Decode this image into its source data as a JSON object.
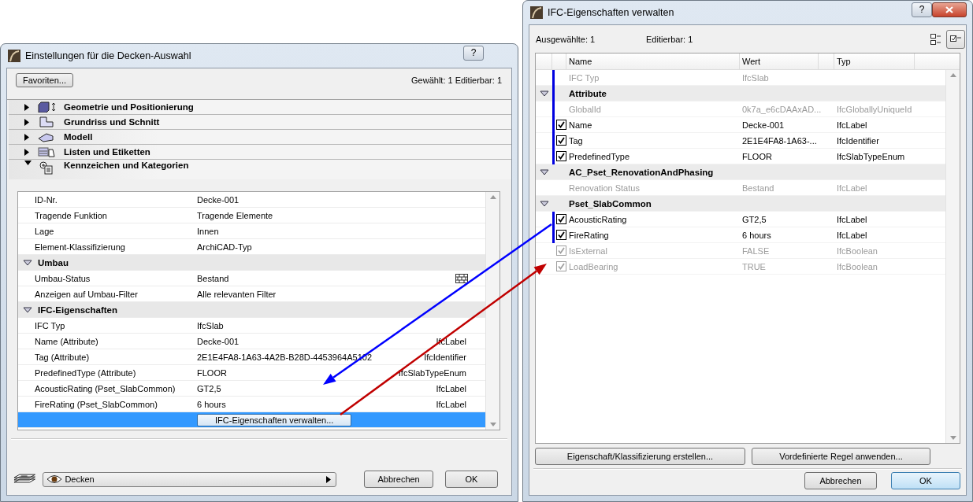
{
  "left_window": {
    "title": "Einstellungen für die Decken-Auswahl",
    "help_button": "?",
    "favorites_button": "Favoriten...",
    "selection_info": "Gewählt: 1 Editierbar: 1",
    "sections": [
      {
        "kind": "geometry",
        "label": "Geometrie und Positionierung",
        "expanded": false
      },
      {
        "kind": "plan",
        "label": "Grundriss und Schnitt",
        "expanded": false
      },
      {
        "kind": "model",
        "label": "Modell",
        "expanded": false
      },
      {
        "kind": "listing",
        "label": "Listen und Etiketten",
        "expanded": false
      },
      {
        "kind": "tags",
        "label": "Kennzeichen und Kategorien",
        "expanded": true
      }
    ],
    "rows": [
      {
        "kind": "row",
        "label": "ID-Nr.",
        "value": "Decke-001",
        "selected": false
      },
      {
        "kind": "row",
        "label": "Tragende Funktion",
        "value": "Tragende Elemente",
        "selected": false
      },
      {
        "kind": "row",
        "label": "Lage",
        "value": "Innen",
        "selected": false
      },
      {
        "kind": "row",
        "label": "Element-Klassifizierung",
        "value": "ArchiCAD-Typ",
        "selected": false
      },
      {
        "kind": "group",
        "label": "Umbau",
        "selected": false
      },
      {
        "kind": "status",
        "label": "Umbau-Status",
        "value": "Bestand",
        "selected": false
      },
      {
        "kind": "row",
        "label": "Anzeigen auf Umbau-Filter",
        "value": "Alle relevanten Filter",
        "selected": false
      },
      {
        "kind": "group",
        "label": "IFC-Eigenschaften",
        "selected": false
      },
      {
        "kind": "row",
        "label": "IFC Typ",
        "value": "IfcSlab",
        "selected": false
      },
      {
        "kind": "row",
        "label": "Name (Attribute)",
        "value": "Decke-001",
        "type": "IfcLabel",
        "selected": false
      },
      {
        "kind": "row",
        "label": "Tag (Attribute)",
        "value": "2E1E4FA8-1A63-4A2B-B28D-4453964A5102",
        "type": "IfcIdentifier",
        "selected": false
      },
      {
        "kind": "row",
        "label": "PredefinedType (Attribute)",
        "value": "FLOOR",
        "type": "IfcSlabTypeEnum",
        "selected": false
      },
      {
        "kind": "row",
        "label": "AcousticRating (Pset_SlabCommon)",
        "value": "GT2,5",
        "type": "IfcLabel",
        "selected": false
      },
      {
        "kind": "row",
        "label": "FireRating (Pset_SlabCommon)",
        "value": "6 hours",
        "type": "IfcLabel",
        "selected": false
      },
      {
        "kind": "action",
        "button": "IFC-Eigenschaften verwalten...",
        "selected": true
      }
    ],
    "layer_dropdown": "Decken",
    "cancel_button": "Abbrechen",
    "ok_button": "OK"
  },
  "right_window": {
    "title": "IFC-Eigenschaften verwalten",
    "help_button": "?",
    "selected_count": "Ausgewählte: 1",
    "editable_count": "Editierbar: 1",
    "view_modes": [
      {
        "kind": "tree",
        "selected": false
      },
      {
        "kind": "checklist",
        "selected": true
      }
    ],
    "columns": [
      "Name",
      "Wert",
      "Typ"
    ],
    "rows": [
      {
        "kind": "field",
        "name": "IFC Typ",
        "value": "IfcSlab",
        "disabled": true,
        "highlighted": true
      },
      {
        "kind": "group",
        "name": "Attribute",
        "expanded": true,
        "highlighted": true
      },
      {
        "kind": "field",
        "name": "GlobalId",
        "value": "0k7a_e6cDAAxAD...",
        "type": "IfcGloballyUniqueId",
        "disabled": true,
        "highlighted": true
      },
      {
        "kind": "check",
        "name": "Name",
        "value": "Decke-001",
        "type": "IfcLabel",
        "checked": true,
        "disabled": false,
        "highlighted": true
      },
      {
        "kind": "check",
        "name": "Tag",
        "value": "2E1E4FA8-1A63-...",
        "type": "IfcIdentifier",
        "checked": true,
        "disabled": false,
        "highlighted": true
      },
      {
        "kind": "check",
        "name": "PredefinedType",
        "value": "FLOOR",
        "type": "IfcSlabTypeEnum",
        "checked": true,
        "disabled": false,
        "highlighted": true
      },
      {
        "kind": "group",
        "name": "AC_Pset_RenovationAndPhasing",
        "expanded": true,
        "highlighted": false
      },
      {
        "kind": "field",
        "name": "Renovation Status",
        "value": "Bestand",
        "type": "IfcLabel",
        "disabled": true,
        "highlighted": false
      },
      {
        "kind": "group",
        "name": "Pset_SlabCommon",
        "expanded": true,
        "highlighted": false
      },
      {
        "kind": "check",
        "name": "AcousticRating",
        "value": "GT2,5",
        "type": "IfcLabel",
        "checked": true,
        "disabled": false,
        "highlighted": true
      },
      {
        "kind": "check",
        "name": "FireRating",
        "value": "6 hours",
        "type": "IfcLabel",
        "checked": true,
        "disabled": false,
        "highlighted": true
      },
      {
        "kind": "check",
        "name": "IsExternal",
        "value": "FALSE",
        "type": "IfcBoolean",
        "checked": true,
        "disabled": true,
        "highlighted": false
      },
      {
        "kind": "check",
        "name": "LoadBearing",
        "value": "TRUE",
        "type": "IfcBoolean",
        "checked": true,
        "disabled": true,
        "highlighted": false
      }
    ],
    "create_button": "Eigenschaft/Klassifizierung erstellen...",
    "rule_button": "Vordefinierte Regel anwenden...",
    "cancel_button": "Abbrechen",
    "ok_button": "OK"
  },
  "arrows": [
    {
      "color": "#0000ff",
      "kind": "to_left"
    },
    {
      "color": "#c00000",
      "kind": "to_right"
    }
  ]
}
